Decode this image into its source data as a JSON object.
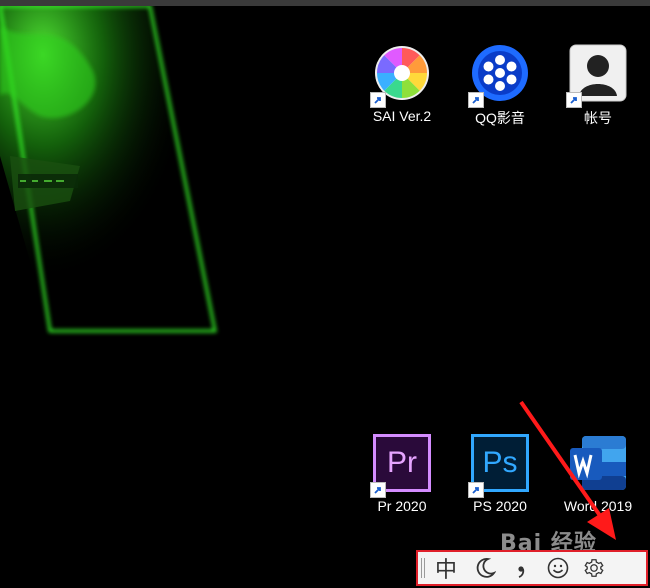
{
  "desktop": {
    "icons": [
      {
        "label": "SAI Ver.2",
        "icon": "sai-color-wheel-icon"
      },
      {
        "label": "QQ影音",
        "icon": "qq-player-film-reel-icon"
      },
      {
        "label": "帐号",
        "icon": "account-person-icon"
      },
      {
        "label": "Pr 2020",
        "icon_text": "Pr",
        "icon": "premiere-pro-icon"
      },
      {
        "label": "PS 2020",
        "icon_text": "Ps",
        "icon": "photoshop-icon"
      },
      {
        "label": "Word 2019",
        "icon": "word-icon"
      }
    ]
  },
  "ime_toolbar": {
    "language_label": "中",
    "items": [
      "grip",
      "language-toggle",
      "half-full-width-moon-icon",
      "punctuation-icon",
      "emoji-smiley-icon",
      "settings-gear-icon"
    ]
  },
  "annotation": {
    "highlight_color": "#e0202a",
    "arrow_color": "#ff1a1a"
  },
  "watermark": "Bai 经验"
}
